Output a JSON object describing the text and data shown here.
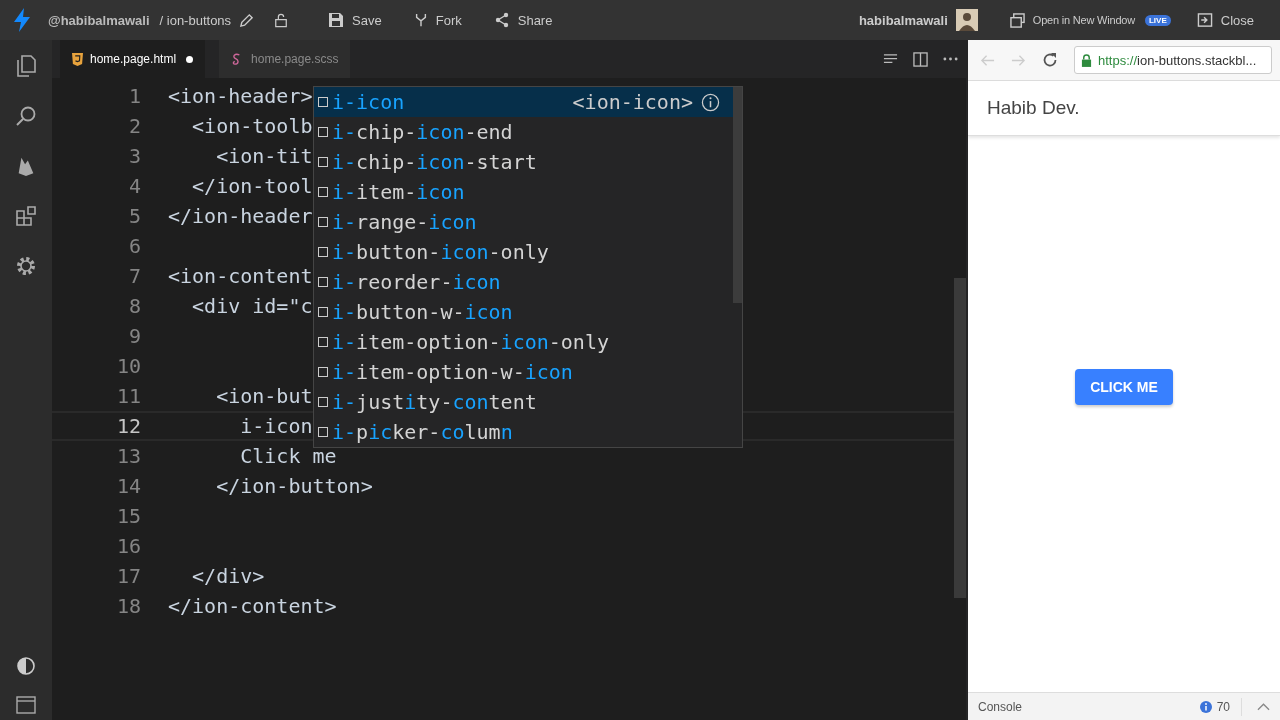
{
  "topbar": {
    "user": "@habibalmawali",
    "project": "/ ion-buttons",
    "actions": [
      {
        "label": "Save",
        "kind": "save"
      },
      {
        "label": "Fork",
        "kind": "fork"
      },
      {
        "label": "Share",
        "kind": "share"
      }
    ],
    "account": "habibalmawali",
    "open_window": "Open in New Window",
    "live_badge": "LIVE",
    "close": "Close"
  },
  "tabs": [
    {
      "label": "home.page.html",
      "kind": "html",
      "selected": true,
      "modified": true
    },
    {
      "label": "home.page.scss",
      "kind": "scss",
      "selected": false,
      "modified": false
    }
  ],
  "editor": {
    "lines": [
      {
        "number": "1",
        "code": "<ion-header>",
        "current": false
      },
      {
        "number": "2",
        "code": "  <ion-toolb",
        "current": false
      },
      {
        "number": "3",
        "code": "    <ion-tit",
        "current": false
      },
      {
        "number": "4",
        "code": "  </ion-tool",
        "current": false
      },
      {
        "number": "5",
        "code": "</ion-header",
        "current": false
      },
      {
        "number": "6",
        "current": false
      },
      {
        "number": "7",
        "code": "<ion-content",
        "current": false
      },
      {
        "number": "8",
        "code": "  <div id=\"c",
        "current": false
      },
      {
        "number": "9",
        "current": false
      },
      {
        "number": "10",
        "current": false
      },
      {
        "number": "11",
        "code": "    <ion-but",
        "current": false
      },
      {
        "number": "12",
        "code": "      i-icon",
        "current": true
      },
      {
        "number": "13",
        "code": "      Click me",
        "current": false
      },
      {
        "number": "14",
        "code": "    </ion-button>",
        "current": false
      },
      {
        "number": "15",
        "current": false
      },
      {
        "number": "16",
        "current": false
      },
      {
        "number": "17",
        "code": "  </div>",
        "current": false
      },
      {
        "number": "18",
        "code": "</ion-content>",
        "current": false
      }
    ]
  },
  "autocomplete": {
    "items": [
      {
        "parts": [
          {
            "text": "i-icon",
            "match": true
          }
        ],
        "detail": "<ion-icon>",
        "selected": true
      },
      {
        "parts": [
          {
            "text": "i-",
            "match": true
          },
          {
            "text": "chip-",
            "match": false
          },
          {
            "text": "icon",
            "match": true
          },
          {
            "text": "-end",
            "match": false
          }
        ],
        "selected": false
      },
      {
        "parts": [
          {
            "text": "i-",
            "match": true
          },
          {
            "text": "chip-",
            "match": false
          },
          {
            "text": "icon",
            "match": true
          },
          {
            "text": "-start",
            "match": false
          }
        ],
        "selected": false
      },
      {
        "parts": [
          {
            "text": "i-",
            "match": true
          },
          {
            "text": "item-",
            "match": false
          },
          {
            "text": "icon",
            "match": true
          }
        ],
        "selected": false
      },
      {
        "parts": [
          {
            "text": "i-",
            "match": true
          },
          {
            "text": "range-",
            "match": false
          },
          {
            "text": "icon",
            "match": true
          }
        ],
        "selected": false
      },
      {
        "parts": [
          {
            "text": "i-",
            "match": true
          },
          {
            "text": "button-",
            "match": false
          },
          {
            "text": "icon",
            "match": true
          },
          {
            "text": "-only",
            "match": false
          }
        ],
        "selected": false
      },
      {
        "parts": [
          {
            "text": "i-",
            "match": true
          },
          {
            "text": "reorder-",
            "match": false
          },
          {
            "text": "icon",
            "match": true
          }
        ],
        "selected": false
      },
      {
        "parts": [
          {
            "text": "i-",
            "match": true
          },
          {
            "text": "button-w-",
            "match": false
          },
          {
            "text": "icon",
            "match": true
          }
        ],
        "selected": false
      },
      {
        "parts": [
          {
            "text": "i-",
            "match": true
          },
          {
            "text": "item-option-",
            "match": false
          },
          {
            "text": "icon",
            "match": true
          },
          {
            "text": "-only",
            "match": false
          }
        ],
        "selected": false
      },
      {
        "parts": [
          {
            "text": "i-",
            "match": true
          },
          {
            "text": "item-option-w-",
            "match": false
          },
          {
            "text": "icon",
            "match": true
          }
        ],
        "selected": false
      },
      {
        "parts": [
          {
            "text": "i-",
            "match": true
          },
          {
            "text": "just",
            "match": false
          },
          {
            "text": "i",
            "match": true
          },
          {
            "text": "ty-",
            "match": false
          },
          {
            "text": "con",
            "match": true
          },
          {
            "text": "tent",
            "match": false
          }
        ],
        "selected": false
      },
      {
        "parts": [
          {
            "text": "i-",
            "match": true
          },
          {
            "text": "p",
            "match": false
          },
          {
            "text": "ic",
            "match": true
          },
          {
            "text": "ker-",
            "match": false
          },
          {
            "text": "co",
            "match": true
          },
          {
            "text": "lum",
            "match": false
          },
          {
            "text": "n",
            "match": true
          }
        ],
        "selected": false
      }
    ]
  },
  "preview": {
    "url_scheme": "https://",
    "url_rest": "ion-buttons.stackbl...",
    "header_title": "Habib Dev.",
    "button": "CLICK ME",
    "console": "Console",
    "message_count": "70"
  }
}
